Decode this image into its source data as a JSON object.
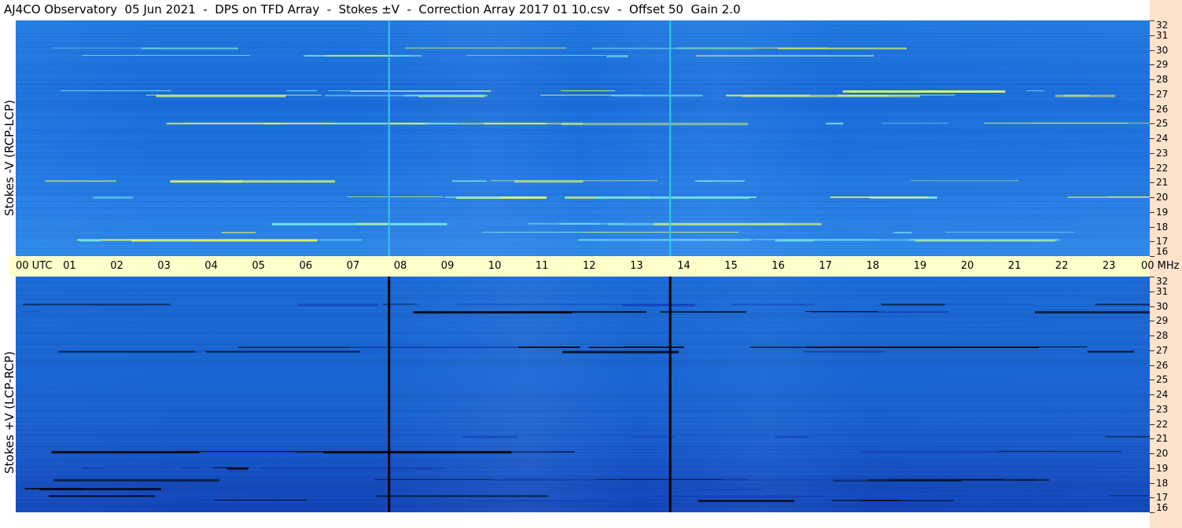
{
  "title": "AJ4CO Observatory  05 Jun 2021  -  DPS on TFD Array  -  Stokes ±V  -  Correction Array 2017 01 10.csv  -  Offset 50  Gain 2.0",
  "chart_data": [
    {
      "type": "heatmap",
      "panel": "top",
      "ylabel": "Stokes -V (RCP-LCP)",
      "xlabel": "UTC",
      "x_ticks": [
        "00 UTC",
        "01",
        "02",
        "03",
        "04",
        "05",
        "06",
        "07",
        "08",
        "09",
        "10",
        "11",
        "12",
        "13",
        "14",
        "15",
        "16",
        "17",
        "18",
        "19",
        "20",
        "21",
        "22",
        "23",
        "00 MHz"
      ],
      "xlim": [
        0,
        24
      ],
      "y_ticks": [
        "16",
        "17",
        "18",
        "19",
        "20",
        "21",
        "22",
        "23",
        "24",
        "25",
        "26",
        "27",
        "28",
        "29",
        "30",
        "31",
        "32"
      ],
      "ylim": [
        16,
        32
      ],
      "y_unit": "MHz",
      "vertical_lines_utc": [
        7.9,
        13.85
      ],
      "vertical_line_color": "#35c8e8",
      "colormap": [
        "#0a2a9a",
        "#1a6cd9",
        "#3ea0f0",
        "#6fe0e8",
        "#d8f070"
      ],
      "bright_bands_mhz": [
        17.1,
        17.6,
        18.2,
        20.0,
        21.1,
        25.0,
        26.9,
        27.2,
        29.6,
        30.1
      ]
    },
    {
      "type": "heatmap",
      "panel": "bottom",
      "ylabel": "Stokes +V (LCP-RCP)",
      "xlabel": "UTC",
      "xlim": [
        0,
        24
      ],
      "y_ticks": [
        "16",
        "17",
        "18",
        "19",
        "20",
        "21",
        "22",
        "23",
        "24",
        "25",
        "26",
        "27",
        "28",
        "29",
        "30",
        "31",
        "32"
      ],
      "ylim": [
        16,
        32
      ],
      "y_unit": "MHz",
      "vertical_lines_utc": [
        7.9,
        13.85
      ],
      "vertical_line_color": "#000000",
      "colormap": [
        "#000814",
        "#1344b8",
        "#1a66d4",
        "#3ea0f0",
        "#d8f070"
      ],
      "dark_bands_mhz": [
        16.8,
        17.1,
        17.6,
        18.2,
        19.0,
        20.1,
        21.1,
        26.9,
        27.2,
        29.6,
        30.1
      ]
    }
  ]
}
